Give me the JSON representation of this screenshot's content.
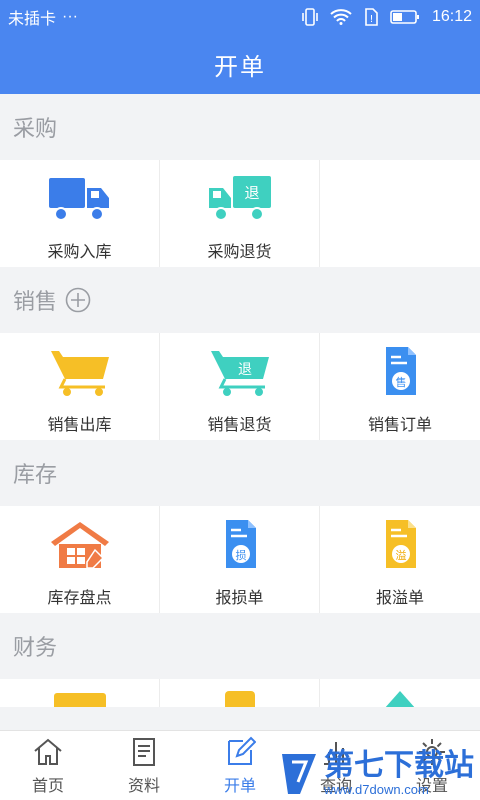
{
  "status": {
    "carrier": "未插卡",
    "more": "···",
    "time": "16:12"
  },
  "header": {
    "title": "开单"
  },
  "sections": [
    {
      "title": "采购",
      "items": [
        {
          "label": "采购入库"
        },
        {
          "label": "采购退货"
        }
      ]
    },
    {
      "title": "销售",
      "items": [
        {
          "label": "销售出库"
        },
        {
          "label": "销售退货"
        },
        {
          "label": "销售订单"
        }
      ]
    },
    {
      "title": "库存",
      "items": [
        {
          "label": "库存盘点"
        },
        {
          "label": "报损单"
        },
        {
          "label": "报溢单"
        }
      ]
    },
    {
      "title": "财务"
    }
  ],
  "icon_glyphs": {
    "tui": "退",
    "shou": "售",
    "sun": "损",
    "yi": "溢"
  },
  "nav": [
    {
      "label": "首页"
    },
    {
      "label": "资料"
    },
    {
      "label": "开单"
    },
    {
      "label": "查询"
    },
    {
      "label": "设置"
    }
  ],
  "watermark": {
    "main": "第七下载站",
    "sub": "www.d7down.com"
  },
  "colors": {
    "primary": "#4a86f0",
    "truck_blue": "#3b7de9",
    "teal": "#3fd0c0",
    "yellow": "#f6bf26",
    "orange": "#f07b45"
  }
}
